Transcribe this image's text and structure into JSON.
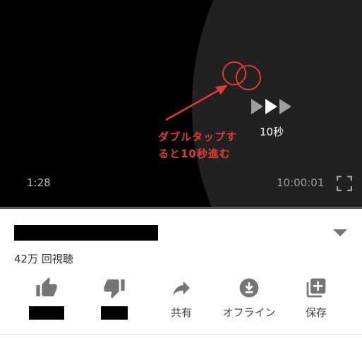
{
  "player": {
    "current_time": "1:28",
    "total_time": "10:00:01",
    "seek_label": "10秒",
    "progress": 0.0
  },
  "annotation": {
    "line1": "ダブルタップす",
    "line2": "ると10秒進む",
    "color": "#e53935"
  },
  "video": {
    "views": "42万 回視聴"
  },
  "actions": {
    "share": "共有",
    "offline": "オフライン",
    "save": "保存"
  },
  "icons": {
    "like": "thumb-up-icon",
    "dislike": "thumb-down-icon",
    "share": "share-arrow-icon",
    "offline": "download-icon",
    "save": "playlist-add-icon",
    "fullscreen": "fullscreen-icon",
    "expand": "chevron-down-icon"
  }
}
